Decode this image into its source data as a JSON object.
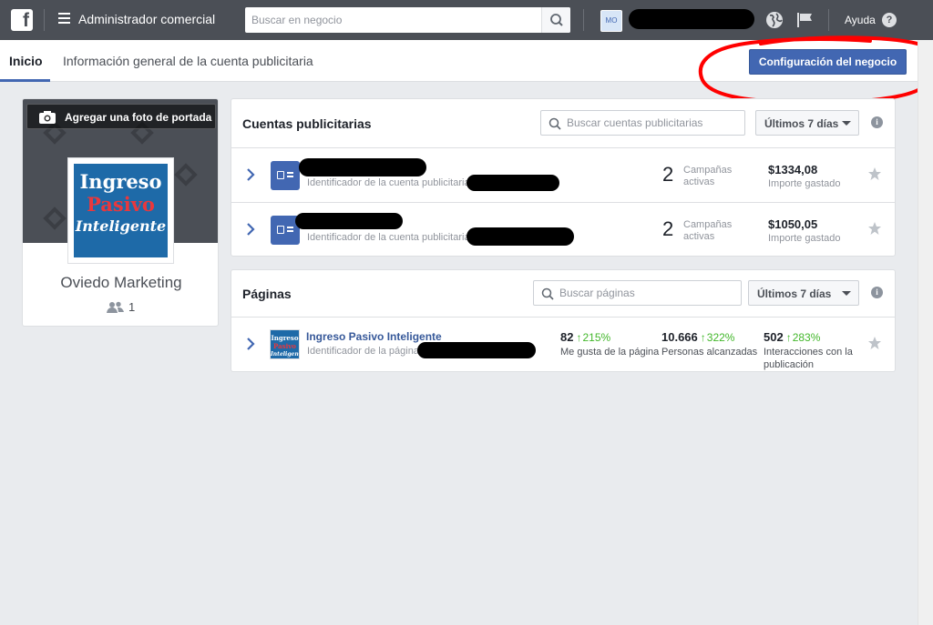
{
  "topbar": {
    "app_title": "Administrador comercial",
    "search_placeholder": "Buscar en negocio",
    "avatar_initials": "MO",
    "help_label": "Ayuda"
  },
  "subnav": {
    "tab_home": "Inicio",
    "tab_overview": "Información general de la cuenta publicitaria",
    "config_button": "Configuración del negocio"
  },
  "business": {
    "cover_button": "Agregar una foto de portada",
    "logo_lines": [
      "Ingreso",
      "Pasivo",
      "Inteligente"
    ],
    "name": "Oviedo Marketing",
    "people_count": "1"
  },
  "ad_accounts": {
    "title": "Cuentas publicitarias",
    "search_placeholder": "Buscar cuentas publicitarias",
    "date_range": "Últimos 7 días",
    "rows": [
      {
        "id_label": "Identificador de la cuenta publicitaria",
        "campaigns": "2",
        "campaigns_label": "Campañas activas",
        "spend": "$1334,08",
        "spend_label": "Importe gastado"
      },
      {
        "id_label": "Identificador de la cuenta publicitaria",
        "campaigns": "2",
        "campaigns_label": "Campañas activas",
        "spend": "$1050,05",
        "spend_label": "Importe gastado"
      }
    ]
  },
  "pages": {
    "title": "Páginas",
    "search_placeholder": "Buscar páginas",
    "date_range": "Últimos 7 días",
    "rows": [
      {
        "name": "Ingreso Pasivo Inteligente",
        "id_label": "Identificador de la página",
        "likes": "82",
        "likes_change": "215%",
        "likes_label": "Me gusta de la página",
        "reach": "10.666",
        "reach_change": "322%",
        "reach_label": "Personas alcanzadas",
        "interactions": "502",
        "interactions_change": "283%",
        "interactions_label": "Interacciones con la publicación"
      }
    ]
  },
  "colors": {
    "topbar": "#4b4f56",
    "primary": "#4267b2",
    "positive": "#42b72a",
    "annotation": "#ff0000"
  }
}
